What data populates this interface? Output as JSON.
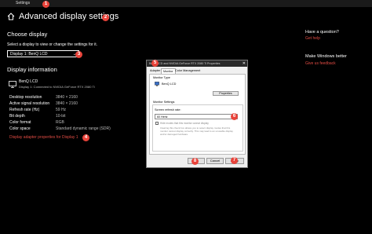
{
  "window": {
    "title": "Settings"
  },
  "page": {
    "title": "Advanced display settings"
  },
  "choose_display": {
    "heading": "Choose display",
    "instruction": "Select a display to view or change the settings for it.",
    "selected": "Display 1: BenQ LCD"
  },
  "display_info": {
    "heading": "Display information",
    "monitor_name": "BenQ LCD",
    "connection": "Display 1: Connected to NVIDIA GeForce RTX 2080 Ti",
    "rows": [
      {
        "label": "Desktop resolution",
        "value": "3840 × 2160"
      },
      {
        "label": "Active signal resolution",
        "value": "3840 × 2160"
      },
      {
        "label": "Refresh rate (Hz)",
        "value": "59 Hz"
      },
      {
        "label": "Bit depth",
        "value": "10-bit"
      },
      {
        "label": "Color format",
        "value": "RGB"
      },
      {
        "label": "Color space",
        "value": "Standard dynamic range (SDR)"
      }
    ],
    "adapter_link": "Display adapter properties for Display 1"
  },
  "sidebar": {
    "question_heading": "Have a question?",
    "question_link": "Get help",
    "improve_heading": "Make Windows better",
    "improve_link": "Give us feedback"
  },
  "dialog": {
    "title": "BenQ LCD and NVIDIA GeForce RTX 2080 Ti Properties",
    "tabs": [
      "Adapter",
      "Monitor",
      "Color Management"
    ],
    "monitor_type_label": "Monitor Type",
    "monitor_type_value": "BenQ LCD",
    "properties_button": "Properties",
    "monitor_settings_label": "Monitor Settings",
    "refresh_label": "Screen refresh rate:",
    "refresh_value": "60 Hertz",
    "hide_modes_label": "Hide modes that this monitor cannot display",
    "hide_modes_help": "Clearing this check box allows you to select display modes that this monitor cannot display correctly. This may lead to an unusable display and/or damaged hardware.",
    "ok_label": "OK",
    "cancel_label": "Cancel",
    "apply_label": "Apply"
  },
  "badges": [
    "1",
    "2",
    "3",
    "4",
    "5",
    "6",
    "7",
    "8"
  ],
  "colors": {
    "accent_red": "#e04b43",
    "badge": "#e8433a",
    "background": "#000000"
  }
}
